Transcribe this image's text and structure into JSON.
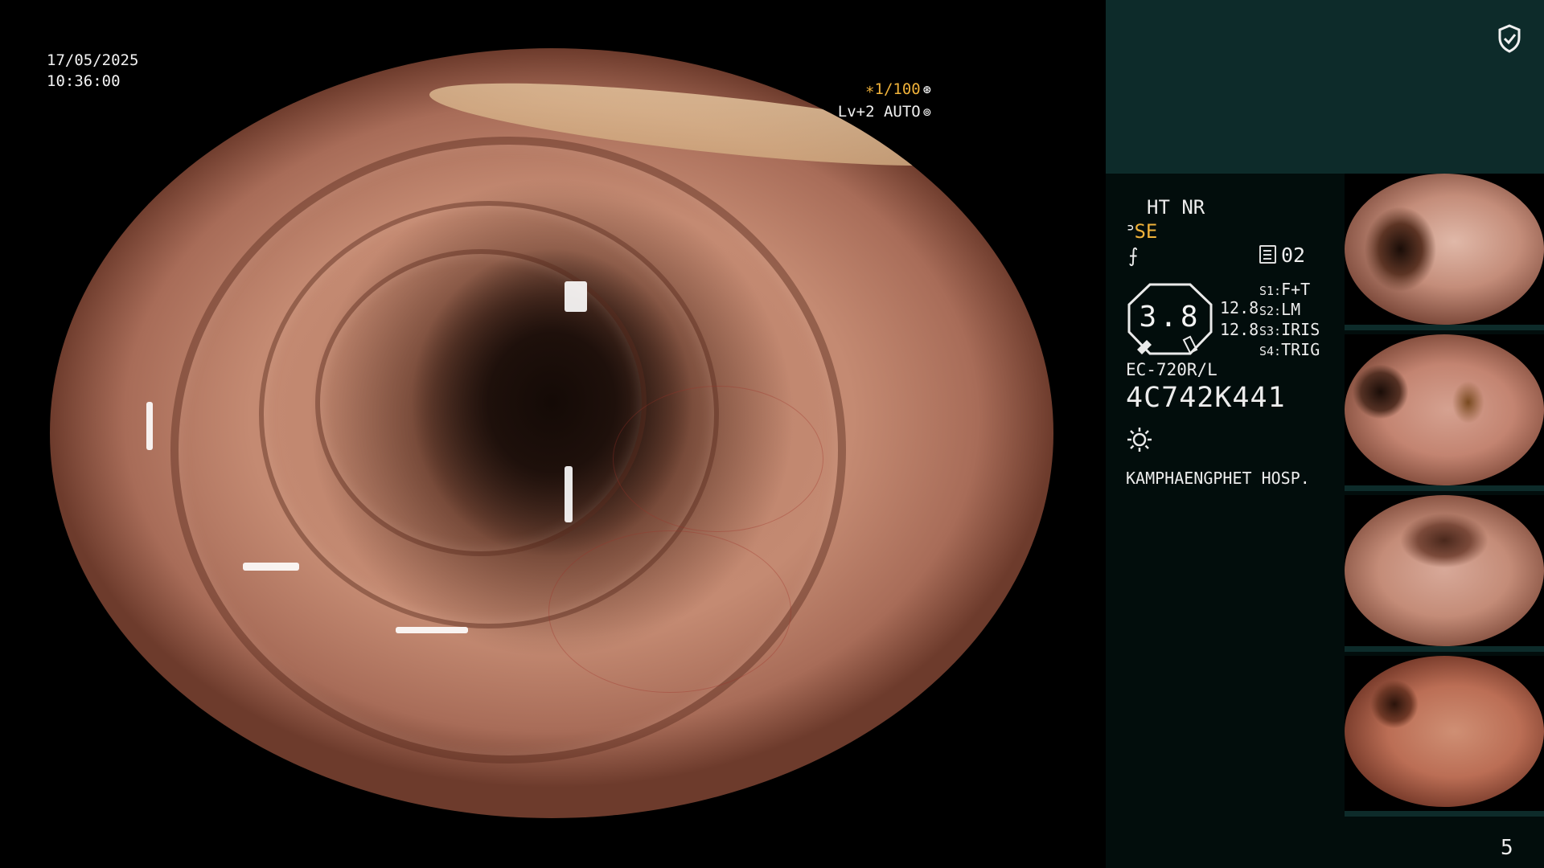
{
  "overlay": {
    "date": "17/05/2025",
    "time": "10:36:00",
    "shutter": "∗1/100",
    "shutter_icon": "aperture-icon",
    "level": "Lv+2 AUTO",
    "level_icon": "iris-icon"
  },
  "panel": {
    "shield_icon": "shield-check-icon",
    "mode": "HT NR",
    "structure_prefix": "ᐣ",
    "structure_mode": "SE",
    "enhance_icon": "⨍",
    "memo_count": "02",
    "zoom": "3.8",
    "zoom_value_a": "12.8",
    "zoom_value_b": "12.8",
    "switches": [
      {
        "key": "S1:",
        "value": "F+T"
      },
      {
        "key": "S2:",
        "value": "LM"
      },
      {
        "key": "S3:",
        "value": "IRIS"
      },
      {
        "key": "S4:",
        "value": "TRIG"
      }
    ],
    "scope_model": "EC-720R/L",
    "serial": "4C742K441",
    "light_icon": "sun-icon",
    "hospital": "KAMPHAENGPHET HOSP.",
    "page_number": "5"
  },
  "colors": {
    "accent": "#f0b23a",
    "panel_top": "#0d2b2a",
    "panel": "#020d0c"
  },
  "thumbnails": [
    "thumbnail-1",
    "thumbnail-2",
    "thumbnail-3",
    "thumbnail-4"
  ]
}
